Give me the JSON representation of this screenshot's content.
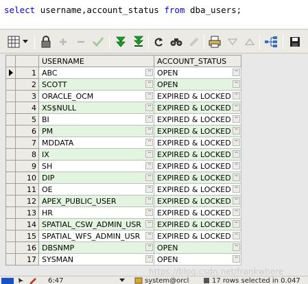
{
  "editor": {
    "sql_keyword_select": "select",
    "sql_columns": "username,account_status",
    "sql_keyword_from": "from",
    "sql_table": "dba_users;"
  },
  "toolbar": {
    "icons": [
      "grid-layout-icon",
      "dropdown-arrow-icon",
      "lock-icon",
      "add-record-icon",
      "delete-record-icon",
      "post-changes-icon",
      "fetch-next-icon",
      "fetch-last-icon",
      "refresh-icon",
      "find-icon",
      "clear-icon",
      "print-icon",
      "sort-descending-icon",
      "sort-ascending-icon",
      "link-icon",
      "save-icon"
    ]
  },
  "grid": {
    "headers": [
      "USERNAME",
      "ACCOUNT_STATUS"
    ],
    "rows": [
      {
        "n": "1",
        "username": "ABC",
        "status": "OPEN"
      },
      {
        "n": "2",
        "username": "SCOTT",
        "status": "OPEN"
      },
      {
        "n": "3",
        "username": "ORACLE_OCM",
        "status": "EXPIRED & LOCKED"
      },
      {
        "n": "4",
        "username": "XS$NULL",
        "status": "EXPIRED & LOCKED"
      },
      {
        "n": "5",
        "username": "BI",
        "status": "EXPIRED & LOCKED"
      },
      {
        "n": "6",
        "username": "PM",
        "status": "EXPIRED & LOCKED"
      },
      {
        "n": "7",
        "username": "MDDATA",
        "status": "EXPIRED & LOCKED"
      },
      {
        "n": "8",
        "username": "IX",
        "status": "EXPIRED & LOCKED"
      },
      {
        "n": "9",
        "username": "SH",
        "status": "EXPIRED & LOCKED"
      },
      {
        "n": "10",
        "username": "DIP",
        "status": "EXPIRED & LOCKED"
      },
      {
        "n": "11",
        "username": "OE",
        "status": "EXPIRED & LOCKED"
      },
      {
        "n": "12",
        "username": "APEX_PUBLIC_USER",
        "status": "EXPIRED & LOCKED"
      },
      {
        "n": "13",
        "username": "HR",
        "status": "EXPIRED & LOCKED"
      },
      {
        "n": "14",
        "username": "SPATIAL_CSW_ADMIN_USR",
        "status": "EXPIRED & LOCKED"
      },
      {
        "n": "15",
        "username": "SPATIAL_WFS_ADMIN_USR",
        "status": "EXPIRED & LOCKED"
      },
      {
        "n": "16",
        "username": "DBSNMP",
        "status": "OPEN"
      },
      {
        "n": "17",
        "username": "SYSMAN",
        "status": "OPEN"
      }
    ],
    "ellipsis": "···"
  },
  "status": {
    "position": "6:47",
    "connection": "system@orcl",
    "result": "17 rows selected in 0.047"
  },
  "watermark": "https://blog.csdn.net/frankwhere"
}
